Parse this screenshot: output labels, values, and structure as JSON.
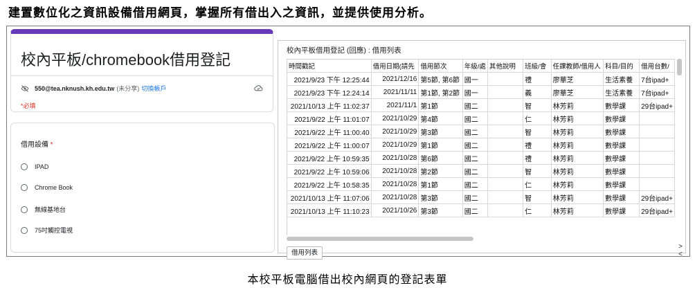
{
  "heading": "建置數位化之資訊設備借用網頁，掌握所有借出入之資訊，並提供使用分析。",
  "caption": "本校平板電腦借出校內網頁的登記表單",
  "form": {
    "title": "校內平板/chromebook借用登記",
    "account_email": "550@tea.nknush.kh.edu.tw",
    "account_note": "(未分享)",
    "switch_account": "切換帳戶",
    "required_note": "*必填",
    "question": {
      "label": "借用設備",
      "required_mark": "*",
      "options": [
        "IPAD",
        "Chrome Book",
        "無線基地台",
        "75吋觸控電視"
      ]
    },
    "icons": {
      "privacy": "eye-off-icon",
      "cloud": "cloud-icon",
      "radio": "radio-button-icon"
    },
    "accent_color": "#673ab7"
  },
  "sheet": {
    "title": "校內平板借用登記 (回應) : 借用列表",
    "headers": [
      "時間戳記",
      "借用日期(請先",
      "借用節次",
      "年級/處",
      "其他說明",
      "班級/會",
      "任課教師/借用人",
      "科目/目的",
      "借用台數/"
    ],
    "rows": [
      [
        "2021/9/23 下午 12:25:44",
        "2021/12/16",
        "第5節, 第6節",
        "國一",
        "",
        "禮",
        "廖華芝",
        "生活素養",
        "7台ipad+"
      ],
      [
        "2021/9/23 下午 12:24:14",
        "2021/11/11",
        "第1節, 第2節",
        "國一",
        "",
        "義",
        "廖華芝",
        "生活素養",
        "7台ipad+"
      ],
      [
        "2021/10/13 上午 11:02:37",
        "2021/11/1",
        "第1節",
        "國二",
        "",
        "智",
        "林芳莉",
        "數學課",
        "29台ipad+"
      ],
      [
        "2021/9/22 上午 11:01:07",
        "2021/10/29",
        "第4節",
        "國二",
        "",
        "仁",
        "林芳莉",
        "數學課",
        ""
      ],
      [
        "2021/9/22 上午 11:00:40",
        "2021/10/29",
        "第3節",
        "國二",
        "",
        "智",
        "林芳莉",
        "數學課",
        ""
      ],
      [
        "2021/9/22 上午 11:00:07",
        "2021/10/29",
        "第1節",
        "國二",
        "",
        "禮",
        "林芳莉",
        "數學課",
        ""
      ],
      [
        "2021/9/22 上午 10:59:35",
        "2021/10/28",
        "第6節",
        "國二",
        "",
        "禮",
        "林芳莉",
        "數學課",
        ""
      ],
      [
        "2021/9/22 上午 10:59:06",
        "2021/10/28",
        "第2節",
        "國二",
        "",
        "智",
        "林芳莉",
        "數學課",
        ""
      ],
      [
        "2021/9/22 上午 10:58:35",
        "2021/10/28",
        "第1節",
        "國二",
        "",
        "仁",
        "林芳莉",
        "數學課",
        ""
      ],
      [
        "2021/10/13 上午 11:07:06",
        "2021/10/28",
        "第3節",
        "國二",
        "",
        "智",
        "林芳莉",
        "數學課",
        "29台ipad+"
      ],
      [
        "2021/10/13 上午 11:10:23",
        "2021/10/26",
        "第3節",
        "國二",
        "",
        "仁",
        "林芳莉",
        "數學課",
        "29台ipad+"
      ]
    ],
    "tab_label": "借用列表",
    "nav_next": ">",
    "nav_prev": "<"
  }
}
